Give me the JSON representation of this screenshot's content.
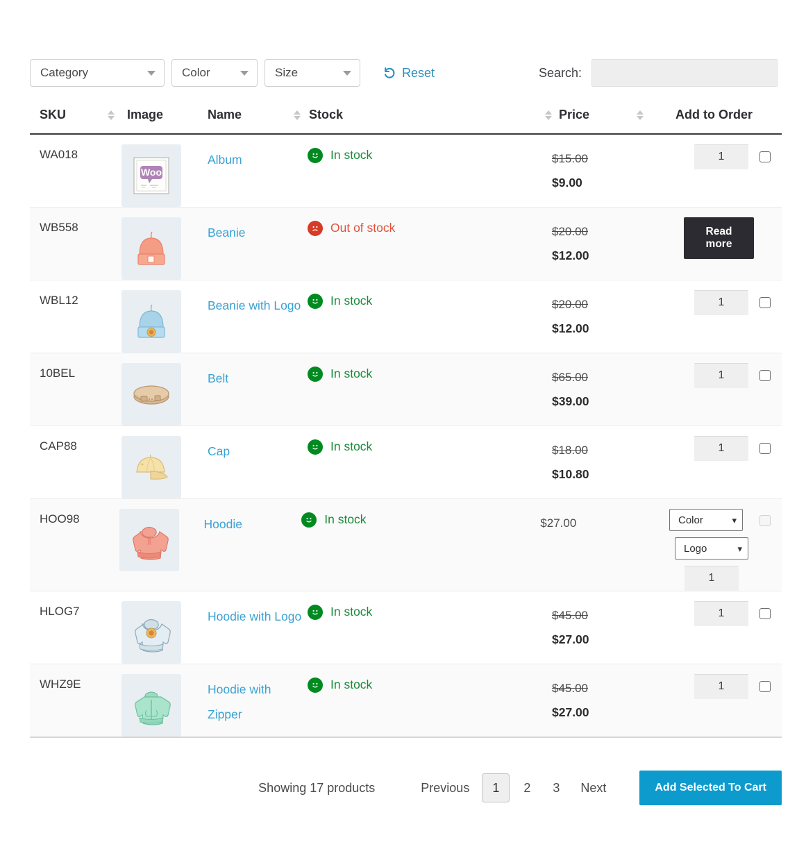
{
  "toolbar": {
    "filters": [
      {
        "name": "category",
        "label": "Category"
      },
      {
        "name": "color",
        "label": "Color"
      },
      {
        "name": "size",
        "label": "Size"
      }
    ],
    "reset_label": "Reset",
    "reset_icon": "undo-arrow-icon",
    "search_label": "Search:",
    "search_value": "",
    "search_placeholder": ""
  },
  "table": {
    "headers": {
      "sku": "SKU",
      "image": "Image",
      "name": "Name",
      "stock": "Stock",
      "price": "Price",
      "add_to_order": "Add to Order"
    },
    "rows": [
      {
        "sku": "WA018",
        "image": "album-thumbnail",
        "name": "Album",
        "stock_status": "In stock",
        "stock_state": "in",
        "price_old": "$15.00",
        "price_new": "$9.00",
        "order_type": "qty",
        "qty": "1"
      },
      {
        "sku": "WB558",
        "image": "beanie-thumbnail",
        "name": "Beanie",
        "stock_status": "Out of stock",
        "stock_state": "out",
        "price_old": "$20.00",
        "price_new": "$12.00",
        "order_type": "readmore",
        "read_more_label": "Read more"
      },
      {
        "sku": "WBL12",
        "image": "beanie-with-logo-thumbnail",
        "name": "Beanie with Logo",
        "stock_status": "In stock",
        "stock_state": "in",
        "price_old": "$20.00",
        "price_new": "$12.00",
        "order_type": "qty",
        "qty": "1"
      },
      {
        "sku": "10BEL",
        "image": "belt-thumbnail",
        "name": "Belt",
        "stock_status": "In stock",
        "stock_state": "in",
        "price_old": "$65.00",
        "price_new": "$39.00",
        "order_type": "qty",
        "qty": "1"
      },
      {
        "sku": "CAP88",
        "image": "cap-thumbnail",
        "name": "Cap",
        "stock_status": "In stock",
        "stock_state": "in",
        "price_old": "$18.00",
        "price_new": "$10.80",
        "order_type": "qty",
        "qty": "1"
      },
      {
        "sku": "HOO98",
        "image": "hoodie-thumbnail",
        "name": "Hoodie",
        "stock_status": "In stock",
        "stock_state": "in",
        "price_plain": "$27.00",
        "order_type": "variable",
        "variation_color": "Color",
        "variation_logo": "Logo",
        "qty": "1"
      },
      {
        "sku": "HLOG7",
        "image": "hoodie-with-logo-thumbnail",
        "name": "Hoodie with Logo",
        "stock_status": "In stock",
        "stock_state": "in",
        "price_old": "$45.00",
        "price_new": "$27.00",
        "order_type": "qty",
        "qty": "1"
      },
      {
        "sku": "WHZ9E",
        "image": "hoodie-with-zipper-thumbnail",
        "name": "Hoodie with Zipper",
        "stock_status": "In stock",
        "stock_state": "in",
        "price_old": "$45.00",
        "price_new": "$27.00",
        "order_type": "qty",
        "qty": "1"
      }
    ]
  },
  "footer": {
    "showing": "Showing 17 products",
    "previous": "Previous",
    "pages": [
      "1",
      "2",
      "3"
    ],
    "active_page": "1",
    "next": "Next",
    "add_to_cart_label": "Add Selected To Cart"
  },
  "colors": {
    "link": "#3aa2d4",
    "in_stock": "#1a8a3a",
    "out_of_stock": "#e2513a",
    "accent_button": "#0d9bce",
    "read_more_button": "#2b2b31",
    "thumb_bg": "#e9eef2"
  }
}
